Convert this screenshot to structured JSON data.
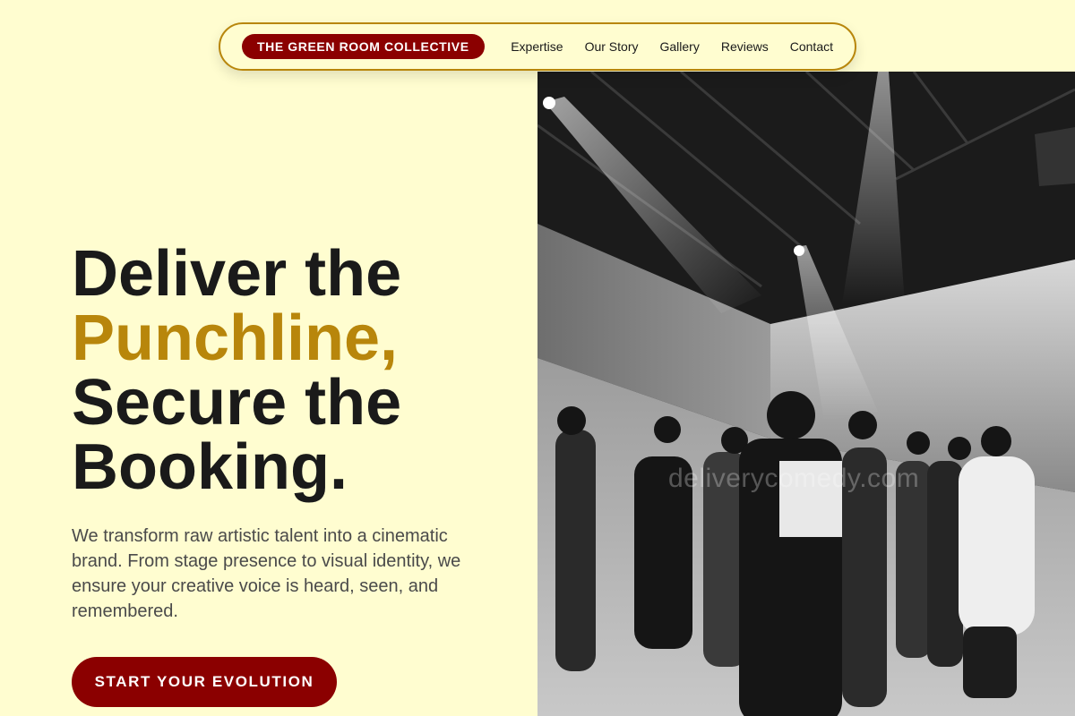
{
  "nav": {
    "brand": "THE GREEN ROOM COLLECTIVE",
    "links": [
      "Expertise",
      "Our Story",
      "Gallery",
      "Reviews",
      "Contact"
    ]
  },
  "hero": {
    "headline_line1": "Deliver the",
    "headline_line2": "Punchline,",
    "headline_line3": "Secure the",
    "headline_line4": "Booking.",
    "subtext": "We transform raw artistic talent into a cinematic brand. From stage presence to visual identity, we ensure your creative voice is heard, seen, and remembered.",
    "cta_label": "START YOUR EVOLUTION"
  },
  "photo": {
    "watermark": "deliverycomedy.com"
  },
  "colors": {
    "background": "#FFFDD0",
    "brand_red": "#8B0000",
    "accent_gold": "#B8860B",
    "text_dark": "#1a1a1a"
  }
}
